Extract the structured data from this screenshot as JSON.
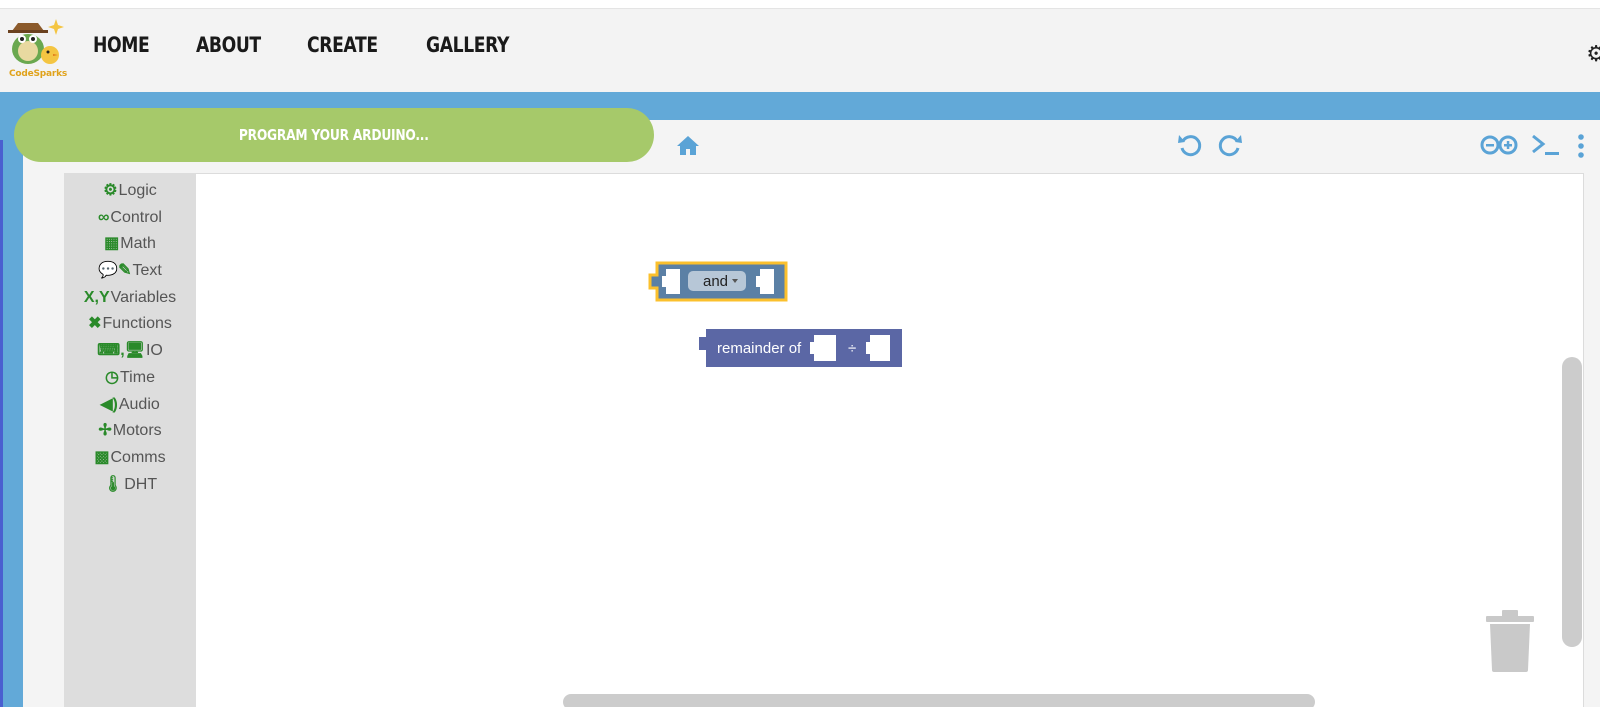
{
  "nav": {
    "logo_text": "CodeSparks",
    "links": [
      "HOME",
      "ABOUT",
      "CREATE",
      "GALLERY"
    ]
  },
  "workspace": {
    "program_label": "PROGRAM YOUR ARDUINO..."
  },
  "toolbox": {
    "categories": [
      {
        "icon": "⚙",
        "label": "Logic"
      },
      {
        "icon": "∞",
        "label": "Control"
      },
      {
        "icon": "▦",
        "label": "Math"
      },
      {
        "icon": "💬✎",
        "label": "Text"
      },
      {
        "icon": "X,Y",
        "label": "Variables"
      },
      {
        "icon": "✖",
        "label": "Functions"
      },
      {
        "icon": "⌨,🖥",
        "label": "IO"
      },
      {
        "icon": "◷",
        "label": "Time"
      },
      {
        "icon": "◀)",
        "label": "Audio"
      },
      {
        "icon": "✢",
        "label": "Motors"
      },
      {
        "icon": "▩",
        "label": "Comms"
      },
      {
        "icon": "🌡",
        "label": "DHT"
      }
    ]
  },
  "blocks": {
    "logic_op": "and",
    "remainder_label": "remainder of",
    "remainder_op": "÷"
  },
  "colors": {
    "nav_bg": "#f3f3f3",
    "band_blue": "#62a9d8",
    "pill_green": "#a6c96a",
    "logic_block": "#5b80a5",
    "math_block": "#5b67a5",
    "selected_outline": "#fbc02d",
    "category_icon": "#2a8a2a"
  }
}
